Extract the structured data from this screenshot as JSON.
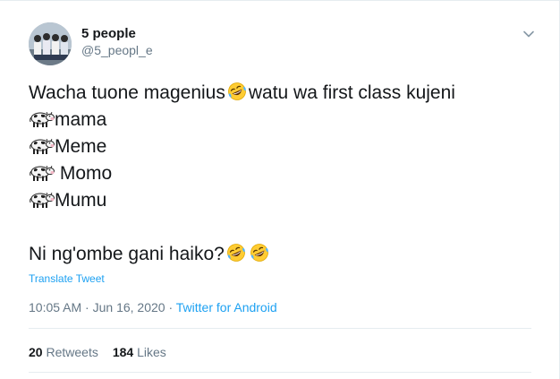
{
  "author": {
    "display_name": "5 people",
    "handle": "@5_peopl_e"
  },
  "tweet": {
    "line1_a": "Wacha tuone magenius",
    "line1_b": "watu wa first class kujeni",
    "options": [
      "mama",
      "Meme",
      " Momo",
      "Mumu"
    ],
    "question": "Ni ng'ombe gani haiko?",
    "emoji": [
      "rolling-on-floor-laughing-emoji",
      "cow-emoji"
    ]
  },
  "translate_label": "Translate Tweet",
  "meta": {
    "time": "10:05 AM",
    "separator1": " · ",
    "date": "Jun 16, 2020",
    "separator2": " · ",
    "source": "Twitter for Android"
  },
  "stats": {
    "retweets_count": "20",
    "retweets_label": "Retweets",
    "likes_count": "184",
    "likes_label": "Likes"
  },
  "colors": {
    "accent": "#1da1f2",
    "muted": "#657786",
    "text": "#14171a",
    "divider": "#e6ecf0"
  }
}
